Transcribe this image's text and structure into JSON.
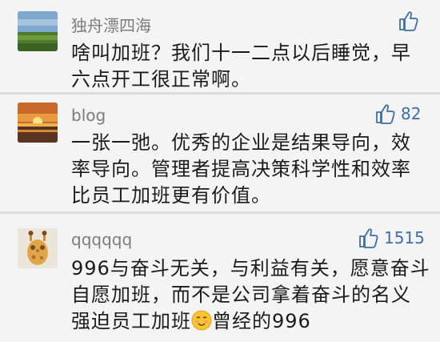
{
  "comments": [
    {
      "user": "独舟漂四海",
      "likes": "",
      "lines": [
        "啥叫加班？我们十一二点以后睡觉，早",
        "六点开工很正常啊。"
      ]
    },
    {
      "user": "blog",
      "likes": "82",
      "lines": [
        "一张一弛。优秀的企业是结果导向，效",
        "率导向。管理者提高决策科学性和效率",
        "比员工加班更有价值。"
      ]
    },
    {
      "user": "qqqqqq",
      "likes": "1515",
      "lines": [
        "996与奋斗无关，与利益有关，愿意奋斗",
        "自愿加班，而不是公司拿着奋斗的名义"
      ],
      "line3_before_emoji": "强迫员工加班",
      "line3_after_emoji": "曾经的996"
    }
  ],
  "icons": {
    "like": "thumbs-up-icon",
    "emoji": "smiling-face-emoji"
  },
  "colors": {
    "like_blue": "#3d6ea7",
    "username_gray": "#7c7c7c",
    "background": "#f4f4f4"
  }
}
